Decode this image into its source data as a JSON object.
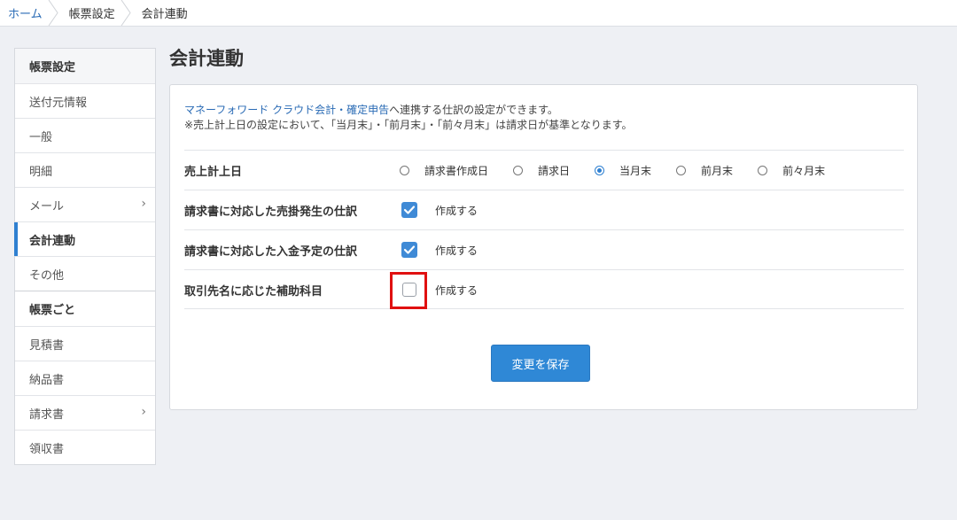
{
  "breadcrumb": [
    "ホーム",
    "帳票設定",
    "会計連動"
  ],
  "sidebar": {
    "items": [
      {
        "label": "帳票設定",
        "type": "header"
      },
      {
        "label": "送付元情報",
        "type": "item"
      },
      {
        "label": "一般",
        "type": "item"
      },
      {
        "label": "明細",
        "type": "item"
      },
      {
        "label": "メール",
        "type": "item",
        "chevron": "›"
      },
      {
        "label": "会計連動",
        "type": "active"
      },
      {
        "label": "その他",
        "type": "item"
      },
      {
        "label": "帳票ごと",
        "type": "section"
      },
      {
        "label": "見積書",
        "type": "item"
      },
      {
        "label": "納品書",
        "type": "item"
      },
      {
        "label": "請求書",
        "type": "item",
        "chevron": "›"
      },
      {
        "label": "領収書",
        "type": "item"
      }
    ]
  },
  "page": {
    "title": "会計連動"
  },
  "intro": {
    "link": "マネーフォワード クラウド会計・確定申告",
    "text1": "へ連携する仕訳の設定ができます。",
    "text2": "※売上計上日の設定において、「当月末」・「前月末」・「前々月末」は請求日が基準となります。"
  },
  "settings": {
    "sales_date": {
      "label": "売上計上日",
      "options": [
        "請求書作成日",
        "請求日",
        "当月末",
        "前月末",
        "前々月末"
      ],
      "selected": "当月末"
    },
    "receivable_entry": {
      "label": "請求書に対応した売掛発生の仕訳",
      "checkbox_label": "作成する",
      "checked": true
    },
    "deposit_entry": {
      "label": "請求書に対応した入金予定の仕訳",
      "checkbox_label": "作成する",
      "checked": true
    },
    "sub_account": {
      "label": "取引先名に応じた補助科目",
      "checkbox_label": "作成する",
      "checked": false
    }
  },
  "save_button": "変更を保存",
  "colors": {
    "accent": "#2f80d1",
    "highlight": "#e01010",
    "link": "#2a6bb5"
  }
}
